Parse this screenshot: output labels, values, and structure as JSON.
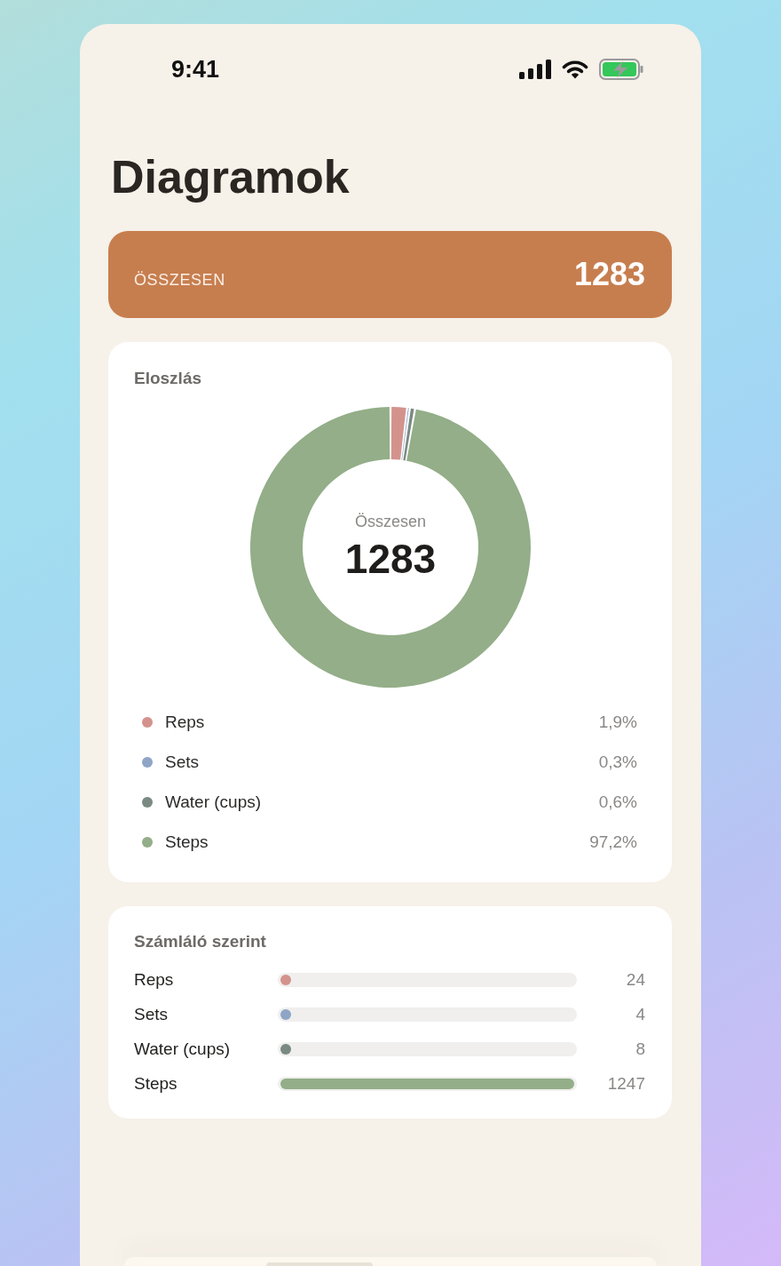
{
  "status_bar": {
    "time": "9:41"
  },
  "title": "Diagramok",
  "total_card": {
    "label": "ÖSSZESEN",
    "value": "1283"
  },
  "distribution": {
    "title": "Eloszlás",
    "center_label": "Összesen",
    "center_value": "1283",
    "chart_data": {
      "type": "donut",
      "categories": [
        "Reps",
        "Sets",
        "Water (cups)",
        "Steps"
      ],
      "values": [
        1.9,
        0.3,
        0.6,
        97.2
      ]
    },
    "legend": [
      {
        "percent": "1,9%",
        "color": "#d3938c"
      },
      {
        "percent": "0,3%",
        "color": "#8ea5c6"
      },
      {
        "percent": "0,6%",
        "color": "#7a8a83"
      },
      {
        "percent": "97,2%",
        "color": "#93ae88"
      }
    ]
  },
  "by_counter": {
    "title": "Számláló szerint",
    "rows": [
      {
        "label": "Reps",
        "value": "24",
        "level": 0.019,
        "color": "#d3938c"
      },
      {
        "label": "Sets",
        "value": "4",
        "level": 0.003,
        "color": "#8ea5c6"
      },
      {
        "label": "Water (cups)",
        "value": "8",
        "level": 0.006,
        "color": "#7a8a83"
      },
      {
        "label": "Steps",
        "value": "1247",
        "level": 1,
        "color": "#93ae88"
      }
    ]
  }
}
